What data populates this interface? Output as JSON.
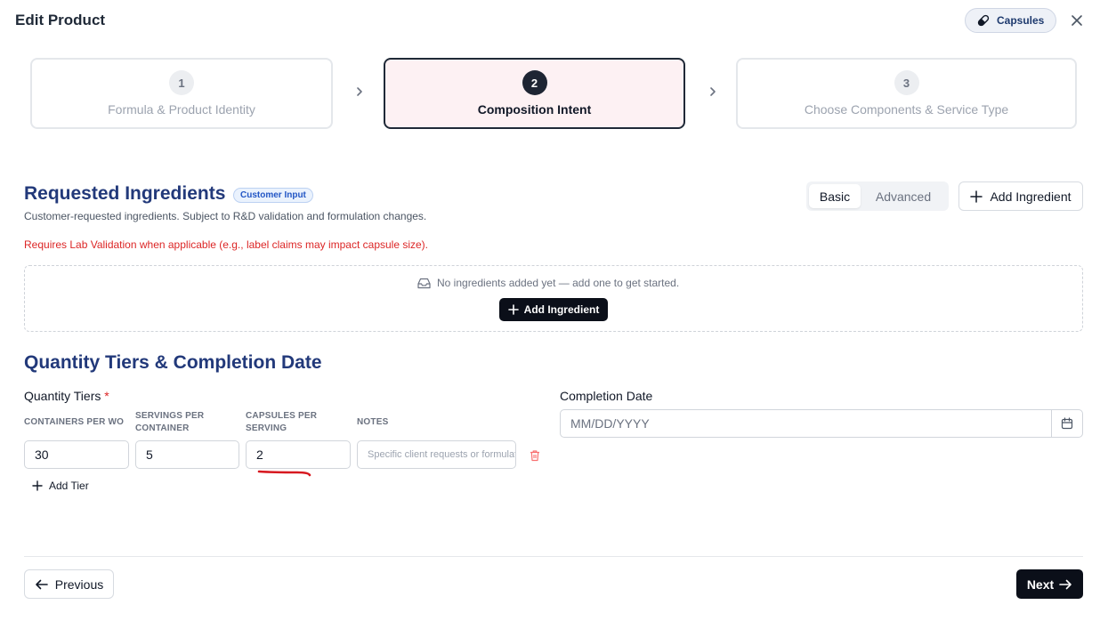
{
  "header": {
    "title": "Edit Product",
    "product_type_chip": "Capsules"
  },
  "steps": [
    {
      "number": "1",
      "label": "Formula & Product Identity",
      "state": "inactive"
    },
    {
      "number": "2",
      "label": "Composition Intent",
      "state": "active"
    },
    {
      "number": "3",
      "label": "Choose Components & Service Type",
      "state": "inactive"
    }
  ],
  "ingredients": {
    "title": "Requested Ingredients",
    "badge": "Customer Input",
    "subtitle": "Customer-requested ingredients. Subject to R&D validation and formulation changes.",
    "warning": "Requires Lab Validation when applicable (e.g., label claims may impact capsule size).",
    "mode_basic": "Basic",
    "mode_advanced": "Advanced",
    "selected_mode": "Basic",
    "add_button": "Add Ingredient",
    "empty_message": "No ingredients added yet — add one to get started.",
    "empty_add_button": "Add Ingredient"
  },
  "quantity": {
    "title": "Quantity Tiers & Completion Date",
    "tiers_label": "Quantity Tiers",
    "required_mark": "*",
    "columns": [
      "CONTAINERS PER WO",
      "SERVINGS PER CONTAINER",
      "CAPSULES PER SERVING",
      "NOTES"
    ],
    "tiers": [
      {
        "containers_per_wo": "30",
        "servings_per_container": "5",
        "capsules_per_serving": "2",
        "notes_placeholder": "Specific client requests or formulation notes"
      }
    ],
    "add_tier": "Add Tier",
    "completion_label": "Completion Date",
    "completion_placeholder": "MM/DD/YYYY"
  },
  "footer": {
    "previous": "Previous",
    "next": "Next"
  },
  "colors": {
    "section_title": "#22397a",
    "active_step_bg": "#fdf1f3",
    "warning": "#dc2626",
    "annotation": "#d71920",
    "primary_button": "#0b0f19"
  },
  "icons": {
    "chip": "capsule-icon",
    "close": "close-icon",
    "step_separator": "chevron-right-icon",
    "empty_state": "inbox-icon",
    "add": "plus-icon",
    "delete_tier": "trash-icon",
    "date_picker": "calendar-icon",
    "previous": "arrow-left-icon",
    "next": "arrow-right-icon"
  }
}
